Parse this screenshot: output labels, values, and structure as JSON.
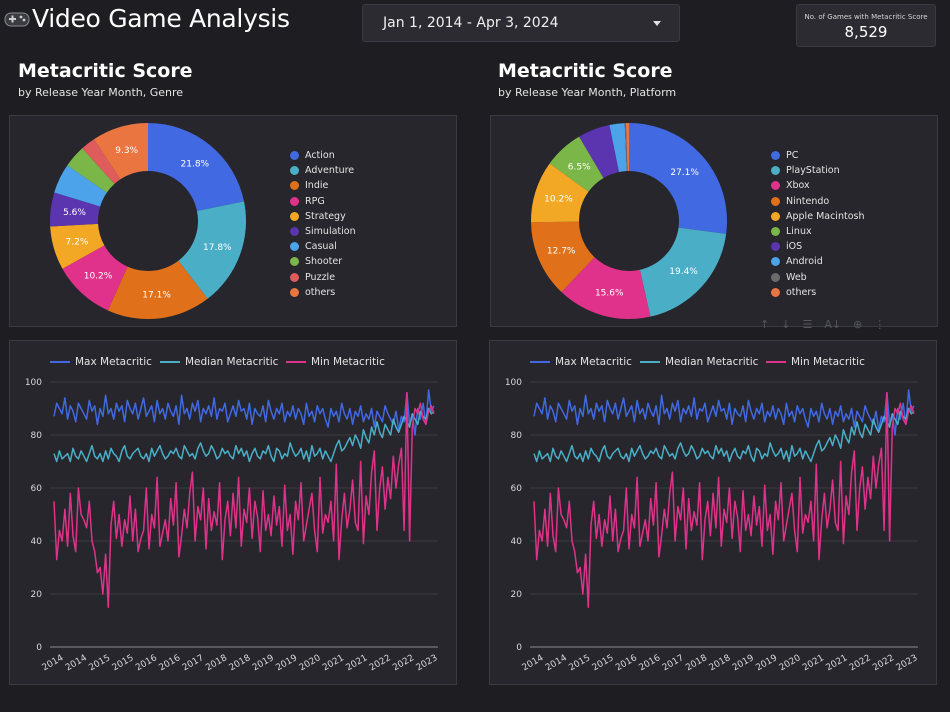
{
  "header": {
    "title": "Video Game Analysis",
    "date_range": "Jan 1, 2014 - Apr 3, 2024",
    "kpi_label": "No. of Games with Metacritic Score",
    "kpi_value": "8,529"
  },
  "sections": [
    {
      "title": "Metacritic Score",
      "subtitle": "by Release Year Month, Genre"
    },
    {
      "title": "Metacritic Score",
      "subtitle": "by Release Year Month, Platform"
    }
  ],
  "toolbar_icons": [
    "arrow-up-icon",
    "arrow-down-icon",
    "filter-icon",
    "sort-az-icon",
    "zoom-icon",
    "more-icon"
  ],
  "chart_data": [
    {
      "type": "pie",
      "donut": true,
      "legend_position": "right",
      "categories": [
        "Action",
        "Adventure",
        "Indie",
        "RPG",
        "Strategy",
        "Simulation",
        "Casual",
        "Shooter",
        "Puzzle",
        "others"
      ],
      "values": [
        21.8,
        17.8,
        17.1,
        10.2,
        7.2,
        5.6,
        4.9,
        3.7,
        2.4,
        9.3
      ],
      "labels": [
        "21.8%",
        "17.8%",
        "17.1%",
        "10.2%",
        "7.2%",
        "5.6%",
        "",
        "",
        "",
        "9.3%"
      ],
      "colors": [
        "#4169e1",
        "#4aafc6",
        "#e0711a",
        "#e0328a",
        "#f2a825",
        "#5b35b0",
        "#4da3ea",
        "#7ab648",
        "#e05c5c",
        "#ea7540"
      ]
    },
    {
      "type": "pie",
      "donut": true,
      "legend_position": "right",
      "categories": [
        "PC",
        "PlayStation",
        "Xbox",
        "Nintendo",
        "Apple Macintosh",
        "Linux",
        "iOS",
        "Android",
        "Web",
        "others"
      ],
      "values": [
        27.1,
        19.4,
        15.6,
        12.7,
        10.2,
        6.5,
        5.3,
        2.5,
        0.2,
        0.5
      ],
      "labels": [
        "27.1%",
        "19.4%",
        "15.6%",
        "12.7%",
        "10.2%",
        "6.5%",
        "",
        "",
        "",
        ""
      ],
      "colors": [
        "#4169e1",
        "#4aafc6",
        "#e0328a",
        "#e0711a",
        "#f2a825",
        "#7ab648",
        "#5b35b0",
        "#4da3ea",
        "#6b6b6b",
        "#ea7540"
      ]
    },
    {
      "type": "line",
      "legend_position": "top",
      "grid": true,
      "ylim": [
        0,
        100
      ],
      "yticks": [
        0,
        20,
        40,
        60,
        80,
        100
      ],
      "xtick_labels": [
        "2014",
        "2014",
        "2015",
        "2015",
        "2016",
        "2016",
        "2017",
        "2018",
        "2018",
        "2019",
        "2019",
        "2020",
        "2021",
        "2021",
        "2022",
        "2022",
        "2023"
      ],
      "series": [
        {
          "name": "Max Metacritic",
          "color": "#4169e1",
          "values": [
            87,
            92,
            90,
            88,
            94,
            86,
            91,
            89,
            85,
            92,
            90,
            88,
            86,
            93,
            89,
            91,
            84,
            90,
            87,
            95,
            88,
            90,
            86,
            92,
            89,
            91,
            85,
            93,
            90,
            88,
            92,
            86,
            90,
            94,
            87,
            89,
            91,
            85,
            93,
            88,
            90,
            86,
            92,
            89,
            87,
            91,
            84,
            95,
            88,
            90,
            86,
            92,
            89,
            93,
            85,
            90,
            88,
            91,
            87,
            94,
            86,
            90,
            89,
            92,
            85,
            88,
            91,
            87,
            93,
            89,
            90,
            86,
            92,
            84,
            90,
            88,
            87,
            91,
            85,
            93,
            89,
            86,
            90,
            88,
            92,
            85,
            89,
            87,
            91,
            86,
            90,
            88,
            84,
            92,
            87,
            89,
            85,
            91,
            88,
            90,
            86,
            83,
            90,
            87,
            89,
            85,
            92,
            88,
            86,
            90,
            84,
            89,
            87,
            91,
            85,
            88,
            86,
            90,
            83,
            89,
            87,
            85,
            91,
            88,
            86,
            84,
            89,
            82,
            87,
            85,
            96,
            84,
            88,
            80,
            90,
            86,
            92,
            84,
            97,
            89,
            91
          ]
        },
        {
          "name": "Median Metacritic",
          "color": "#4aafc6",
          "values": [
            73,
            70,
            74,
            71,
            72,
            73,
            70,
            75,
            72,
            71,
            74,
            72,
            70,
            73,
            76,
            72,
            71,
            73,
            70,
            74,
            71,
            75,
            73,
            72,
            70,
            74,
            76,
            72,
            71,
            73,
            74,
            75,
            72,
            71,
            73,
            70,
            75,
            72,
            74,
            76,
            73,
            71,
            72,
            74,
            73,
            75,
            72,
            71,
            76,
            74,
            72,
            73,
            71,
            75,
            77,
            74,
            72,
            73,
            76,
            74,
            71,
            72,
            75,
            73,
            74,
            72,
            71,
            76,
            73,
            75,
            72,
            74,
            70,
            73,
            75,
            72,
            71,
            74,
            73,
            76,
            72,
            70,
            75,
            74,
            71,
            73,
            72,
            77,
            74,
            72,
            73,
            75,
            71,
            74,
            70,
            76,
            72,
            73,
            75,
            71,
            74,
            72,
            70,
            73,
            76,
            78,
            74,
            75,
            77,
            79,
            76,
            80,
            78,
            75,
            82,
            79,
            77,
            83,
            80,
            85,
            81,
            79,
            84,
            82,
            80,
            86,
            83,
            81,
            84,
            87,
            85,
            83,
            88,
            86,
            84,
            89,
            87,
            86,
            90,
            88,
            89
          ]
        },
        {
          "name": "Min Metacritic",
          "color": "#e0328a",
          "values": [
            55,
            33,
            44,
            40,
            52,
            38,
            58,
            42,
            36,
            60,
            50,
            48,
            45,
            55,
            40,
            36,
            28,
            30,
            20,
            35,
            15,
            46,
            55,
            41,
            50,
            38,
            48,
            43,
            57,
            40,
            52,
            36,
            41,
            44,
            60,
            37,
            50,
            45,
            64,
            38,
            43,
            48,
            40,
            56,
            46,
            62,
            34,
            42,
            52,
            45,
            58,
            66,
            40,
            53,
            48,
            60,
            37,
            56,
            44,
            51,
            46,
            62,
            33,
            48,
            55,
            42,
            58,
            45,
            64,
            38,
            52,
            47,
            60,
            41,
            55,
            49,
            36,
            59,
            44,
            50,
            42,
            57,
            46,
            53,
            38,
            61,
            44,
            50,
            35,
            55,
            48,
            62,
            40,
            46,
            52,
            58,
            44,
            36,
            64,
            43,
            50,
            47,
            55,
            40,
            69,
            33,
            48,
            58,
            45,
            52,
            63,
            47,
            44,
            70,
            39,
            57,
            50,
            66,
            74,
            44,
            60,
            68,
            52,
            64,
            56,
            72,
            60,
            69,
            75,
            44,
            96,
            40,
            83,
            90,
            88,
            92,
            86,
            84,
            89,
            91,
            88
          ]
        }
      ]
    }
  ]
}
